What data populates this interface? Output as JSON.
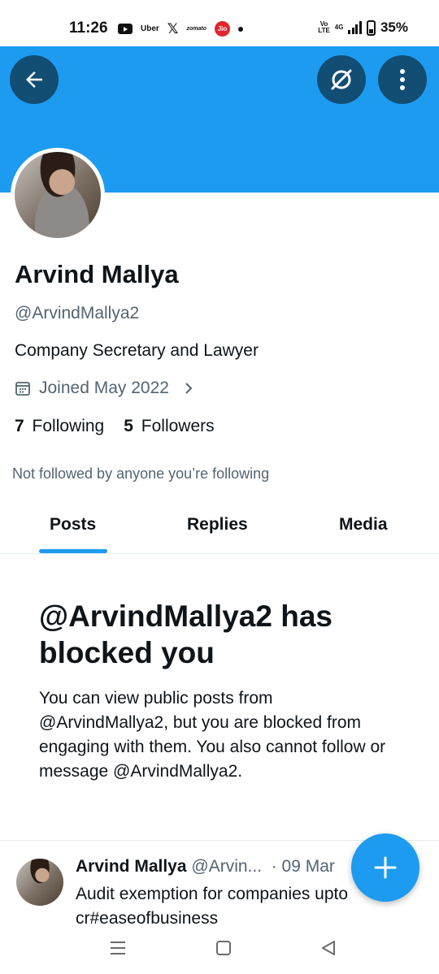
{
  "status_bar": {
    "time": "11:26",
    "apps": [
      "youtube-icon",
      "uber-icon",
      "x-icon",
      "zomato-icon",
      "jio-icon"
    ],
    "uber_label": "Uber",
    "x_label": "𝕏",
    "zomato_label": "zomato",
    "jio_label": "Jio",
    "volte_label": "Vo\nLTE",
    "network": "4G",
    "battery": "35%"
  },
  "colors": {
    "banner": "#1d9bf0",
    "accent": "#1d9bf0",
    "button_dark": "#124d73"
  },
  "profile": {
    "name": "Arvind Mallya",
    "handle": "@ArvindMallya2",
    "bio": "Company Secretary and Lawyer",
    "joined": "Joined May 2022",
    "following_count": "7",
    "following_label": "Following",
    "followers_count": "5",
    "followers_label": "Followers",
    "not_followed": "Not followed by anyone you’re following"
  },
  "tabs": [
    {
      "label": "Posts",
      "active": true
    },
    {
      "label": "Replies",
      "active": false
    },
    {
      "label": "Media",
      "active": false
    }
  ],
  "blocked": {
    "title": "@ArvindMallya2 has blocked you",
    "body": "You can view public posts from @ArvindMallya2, but you are blocked from engaging with them. You also cannot follow or message @ArvindMallya2."
  },
  "tweet": {
    "author": "Arvind Mallya",
    "handle": "@Arvin...",
    "date": "· 09 Mar",
    "text": "Audit exemption for companies upto",
    "text_line2_prefix": "cr",
    "hashtag": "#easeofbusiness"
  },
  "fab": {
    "icon": "plus-icon"
  },
  "nav": [
    "recents-icon",
    "home-icon",
    "back-triangle-icon"
  ]
}
